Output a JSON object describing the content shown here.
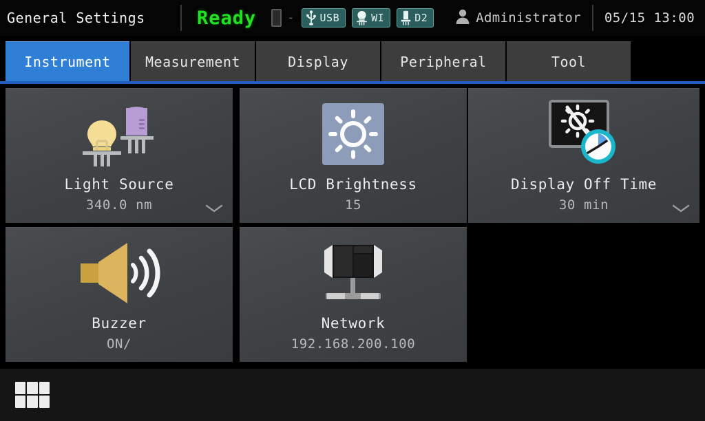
{
  "header": {
    "title": "General Settings",
    "status": "Ready",
    "device_slot_icon": "device-slot-icon",
    "slot_dash": "-",
    "badges": [
      {
        "icon": "usb-icon",
        "label": "USB"
      },
      {
        "icon": "tungsten-lamp-icon",
        "label": "WI"
      },
      {
        "icon": "deuterium-lamp-icon",
        "label": "D2"
      }
    ],
    "user_icon": "user-icon",
    "user": "Administrator",
    "datetime": "05/15 13:00",
    "accent_ready_color": "#22e022",
    "badge_bg_color": "#2b5f5d"
  },
  "tabs": [
    {
      "label": "Instrument",
      "active": true
    },
    {
      "label": "Measurement",
      "active": false
    },
    {
      "label": "Display",
      "active": false
    },
    {
      "label": "Peripheral",
      "active": false
    },
    {
      "label": "Tool",
      "active": false
    }
  ],
  "tab_accent_color": "#2f7fd6",
  "cards": [
    {
      "icon": "light-source-icon",
      "title": "Light Source",
      "value": "340.0 nm",
      "chevron": true
    },
    {
      "icon": "brightness-sun-icon",
      "title": "LCD Brightness",
      "value": "15",
      "chevron": false
    },
    {
      "icon": "display-off-time-icon",
      "title": "Display Off Time",
      "value": "30 min",
      "chevron": true
    },
    {
      "icon": "buzzer-speaker-icon",
      "title": "Buzzer",
      "value": "ON/",
      "chevron": false
    },
    {
      "icon": "network-monitor-icon",
      "title": "Network",
      "value": "192.168.200.100",
      "chevron": false
    }
  ],
  "footer": {
    "menu_button_icon": "grid-menu-icon"
  }
}
